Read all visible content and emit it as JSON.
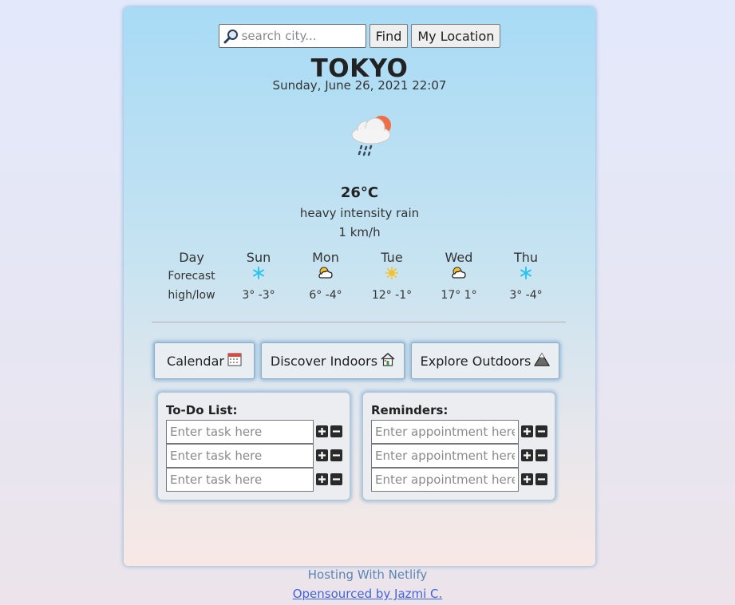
{
  "search": {
    "placeholder": "search city...",
    "value": "",
    "find_label": "Find",
    "location_label": "My Location"
  },
  "weather": {
    "city": "TOKYO",
    "datetime": "Sunday, June 26, 2021 22:07",
    "icon": "cloud-sun-rain-icon",
    "temperature": "26°C",
    "description": "heavy intensity rain",
    "wind": "1 km/h"
  },
  "forecast": {
    "labels": {
      "day": "Day",
      "forecast": "Forecast",
      "highlow": "high/low"
    },
    "days": [
      {
        "day": "Sun",
        "icon": "snowflake-icon",
        "highlow": "3° -3°"
      },
      {
        "day": "Mon",
        "icon": "sun-cloud-icon",
        "highlow": "6° -4°"
      },
      {
        "day": "Tue",
        "icon": "sun-icon",
        "highlow": "12° -1°"
      },
      {
        "day": "Wed",
        "icon": "sun-cloud-icon",
        "highlow": "17° 1°"
      },
      {
        "day": "Thu",
        "icon": "snowflake-icon",
        "highlow": "3° -4°"
      }
    ]
  },
  "actions": {
    "calendar": "Calendar",
    "indoors": "Discover Indoors",
    "outdoors": "Explore Outdoors"
  },
  "todo": {
    "title": "To-Do List:",
    "placeholder": "Enter task here"
  },
  "reminders": {
    "title": "Reminders:",
    "placeholder": "Enter appointment here"
  },
  "footer": {
    "hosting": "Hosting With Netlify",
    "link": "Opensourced by Jazmi C."
  },
  "colors": {
    "card_top": "#a8dbf6",
    "card_bottom": "#f8e8e5",
    "link": "#3f64e0",
    "snowflake": "#2ec4f0",
    "sun": "#f6c12a",
    "cloud_sun": "#ef6e47"
  }
}
